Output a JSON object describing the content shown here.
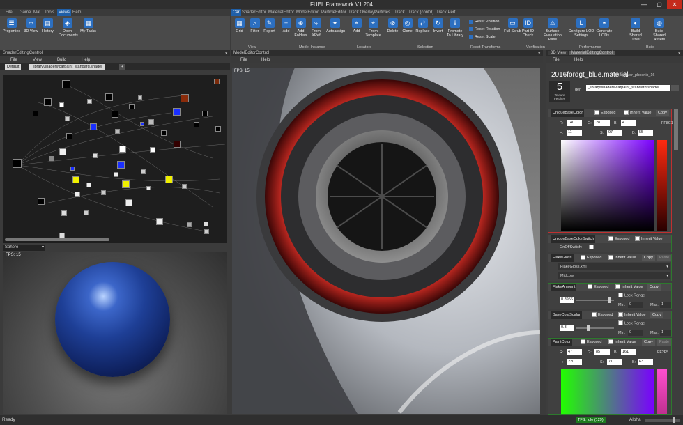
{
  "window": {
    "title": "FUEL Framework V1.204",
    "minimize": "—",
    "maximize": "▢",
    "close": "✕"
  },
  "menus": {
    "left": [
      "File",
      "Game",
      "Mat",
      "Tools",
      "Views",
      "Help"
    ],
    "right": [
      "Car",
      "ShaderEditor",
      "MaterialEditor",
      "ModelEditor",
      "ParticleEditor",
      "Track Overlays",
      "Particles",
      "Track",
      "Track (cont'd)",
      "Track Perf"
    ]
  },
  "ribbon_left": [
    {
      "label": "Properties"
    },
    {
      "label": "3D View"
    },
    {
      "label": "History"
    },
    {
      "label": "Open Documents"
    },
    {
      "label": "My Tasks"
    }
  ],
  "ribbon_right": [
    {
      "label": "Grid"
    },
    {
      "label": "Filter"
    },
    {
      "label": "Report"
    },
    {
      "label": "Add"
    },
    {
      "label": "Add Folders"
    },
    {
      "label": "From XRef"
    },
    {
      "label": "Autoassign"
    },
    {
      "label": "Add"
    },
    {
      "label": "From Template"
    },
    {
      "label": "Delete"
    },
    {
      "label": "Clone"
    },
    {
      "label": "Replace"
    },
    {
      "label": "Invert"
    },
    {
      "label": "Promote To Library"
    },
    {
      "label": "Full Scrub"
    },
    {
      "label": "Part ID Check"
    },
    {
      "label": "Surface Evaluation Pass"
    },
    {
      "label": "Configure LOD Settings"
    },
    {
      "label": "Generate LODs"
    },
    {
      "label": "Build Shared Driver"
    },
    {
      "label": "Build Shared Assets"
    }
  ],
  "ribbon_small": [
    "Reset Position",
    "Reset Rotation",
    "Reset Scale"
  ],
  "ribbon_groups": [
    "View",
    "Model Instance",
    "Locators",
    "Selection",
    "Reset Transforms",
    "Verification",
    "Performance",
    "Build"
  ],
  "shader_panel": {
    "title": "ShaderEditingControl",
    "menu": [
      "File",
      "View",
      "Build",
      "Help"
    ],
    "tabs": [
      "Default",
      "_library\\shaders\\carpaint_standard.shader",
      "+"
    ],
    "preview_select": "Sphere",
    "fps": "FPS: 15"
  },
  "model_panel": {
    "title": "ModelEditorControl",
    "menu": [
      "File",
      "Help"
    ],
    "fps": "FPS: 15"
  },
  "material_panel": {
    "tabs": [
      "3D View",
      "MaterialEditingControl"
    ],
    "menu": [
      "File",
      "Help"
    ],
    "name": "2016fordgt_blue.material",
    "path": "(in cars\\for_phoenix_16",
    "fetch_count": "5",
    "fetch_label": "Texture Fetches",
    "shader_label": "der:",
    "shader_path": "_library\\shaders\\carpaint_standard.shader",
    "browse": "..."
  },
  "props": {
    "exposed": "Exposed",
    "inherit": "Inherit Value",
    "copy": "Copy",
    "paste": "Paste",
    "lock": "Lock Range",
    "min": "Min:",
    "max": "Max:",
    "unique_base_color": {
      "name": "UniqueBaseColor",
      "r": "140",
      "g": "28",
      "b": "4",
      "hex": "FF8C1",
      "h": "11",
      "s": "97",
      "v": "55"
    },
    "unique_switch": {
      "name": "UniqueBaseColorSwitch",
      "sub": "OnOffSwitch:"
    },
    "flake_gloss": {
      "name": "FlakeGloss",
      "file": "FlakeGloss.xml",
      "level": "MidLow"
    },
    "flake_amount": {
      "name": "FlakeAmount",
      "value": "0.8956",
      "min": "0",
      "max": "1"
    },
    "base_coat": {
      "name": "BaseCoatScalar",
      "value": "0.3",
      "min": "0",
      "max": "1"
    },
    "paint_color": {
      "name": "PaintColor",
      "r": "47",
      "g": "85",
      "b": "161",
      "hex": "FF2F5",
      "h": "220",
      "s": "71",
      "v": "63"
    }
  },
  "status": {
    "left": "Ready",
    "tfs": "TFS: Idle (129)",
    "alpha": "Alpha"
  },
  "colors": {
    "accent": "#1f5fa8",
    "unique_base": "#8c1c04",
    "paint": "#2f55a1"
  }
}
